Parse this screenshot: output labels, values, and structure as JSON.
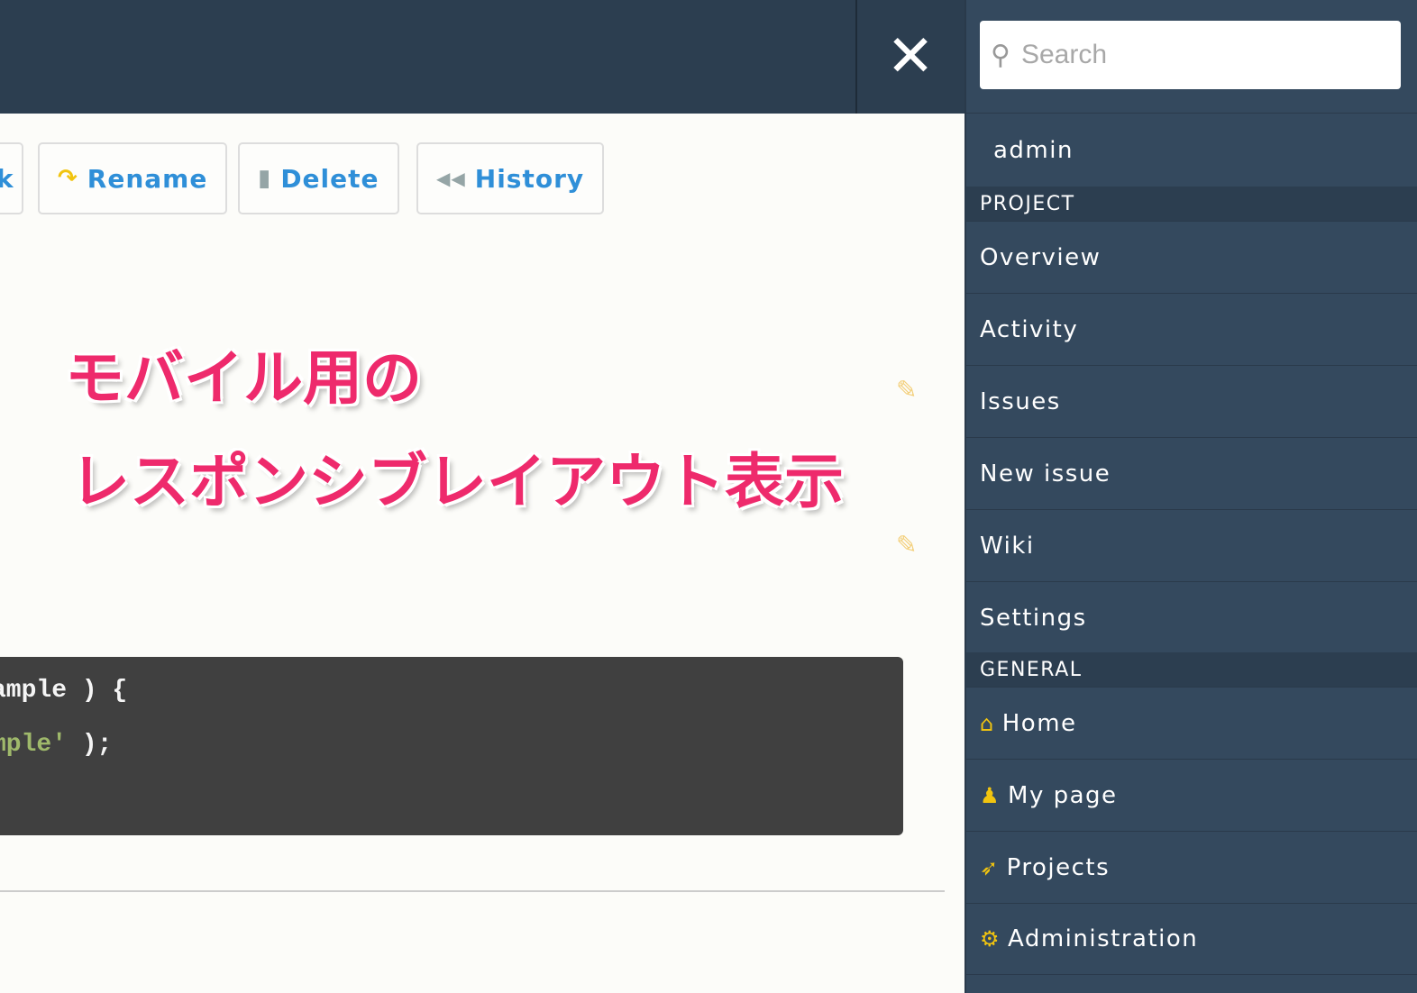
{
  "topbar": {
    "close_icon": "close-icon"
  },
  "toolbar": {
    "partial_label": "k",
    "rename_label": "Rename",
    "delete_label": "Delete",
    "history_label": "History"
  },
  "overlay": {
    "line1": "モバイル用の",
    "line2": "レスポンシブレイアウト表示"
  },
  "code": {
    "line1": "ample ) {",
    "line2_str": "mple'",
    "line2_rest": " );"
  },
  "sidebar": {
    "search_placeholder": "Search",
    "user": "admin",
    "project_header": "PROJECT",
    "project_items": [
      {
        "label": "Overview"
      },
      {
        "label": "Activity"
      },
      {
        "label": "Issues"
      },
      {
        "label": "New issue"
      },
      {
        "label": "Wiki"
      },
      {
        "label": "Settings"
      }
    ],
    "general_header": "GENERAL",
    "general_items": [
      {
        "label": "Home",
        "icon": "home-icon"
      },
      {
        "label": "My page",
        "icon": "user-icon"
      },
      {
        "label": "Projects",
        "icon": "rocket-icon"
      },
      {
        "label": "Administration",
        "icon": "gear-icon"
      }
    ]
  },
  "colors": {
    "accent": "#2f8fd8",
    "sidebar": "#34495e",
    "topbar": "#2c3e50",
    "icon": "#f1c40f",
    "overlay": "#ee2a6c"
  }
}
